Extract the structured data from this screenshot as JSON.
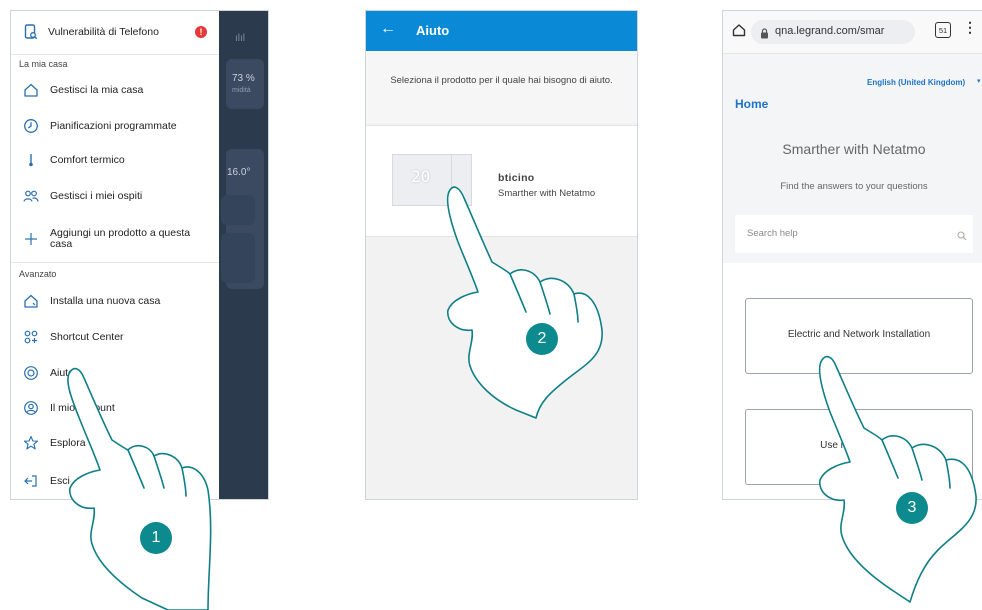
{
  "colors": {
    "accent_blue": "#0a8ad6",
    "legrand_blue": "#1e73c8",
    "badge_teal": "#0d8a8e",
    "alert_red": "#e53935",
    "dark_panel": "#2c3a4e"
  },
  "step1": {
    "header_item": {
      "label": "Vulnerabilità di Telefono",
      "icon": "phone-search-icon",
      "alert_badge": "!"
    },
    "section_home": "La mia casa",
    "home_items": [
      {
        "label": "Gestisci la mia casa",
        "icon": "home-icon"
      },
      {
        "label": "Pianificazioni programmate",
        "icon": "clock-icon"
      },
      {
        "label": "Comfort termico",
        "icon": "thermometer-icon"
      },
      {
        "label": "Gestisci i miei ospiti",
        "icon": "guests-icon"
      },
      {
        "label": "Aggiungi un prodotto a questa casa",
        "icon": "plus-icon"
      }
    ],
    "section_advanced": "Avanzato",
    "advanced_items": [
      {
        "label": "Installa una nuova casa",
        "icon": "new-home-icon"
      },
      {
        "label": "Shortcut Center",
        "icon": "shortcut-grid-icon"
      },
      {
        "label": "Aiuto",
        "icon": "lifebuoy-icon"
      },
      {
        "label": "Il mio account",
        "icon": "account-icon"
      },
      {
        "label": "Esplora",
        "icon": "star-icon"
      },
      {
        "label": "Esci",
        "icon": "logout-icon"
      }
    ],
    "background_values": {
      "humidity": "73 %",
      "humidity_sub": "midità",
      "temperature": "16.0°"
    },
    "step_number": "1"
  },
  "step2": {
    "header_title": "Aiuto",
    "back_icon": "back-arrow-icon",
    "intro_text": "Seleziona il prodotto per il quale hai bisogno di aiuto.",
    "product": {
      "brand": "bticino",
      "name": "Smarther with Netatmo",
      "display_temp": "20"
    },
    "step_number": "2"
  },
  "step3": {
    "url": "qna.legrand.com/smar",
    "tab_count": "51",
    "language": "English (United Kingdom)",
    "home_link": "Home",
    "title": "Smarther with Netatmo",
    "subtitle": "Find the answers to your questions",
    "search_placeholder": "Search help",
    "buttons": [
      {
        "label": "Electric and Network Installation"
      },
      {
        "label": "Use my Smarther"
      }
    ],
    "step_number": "3"
  }
}
